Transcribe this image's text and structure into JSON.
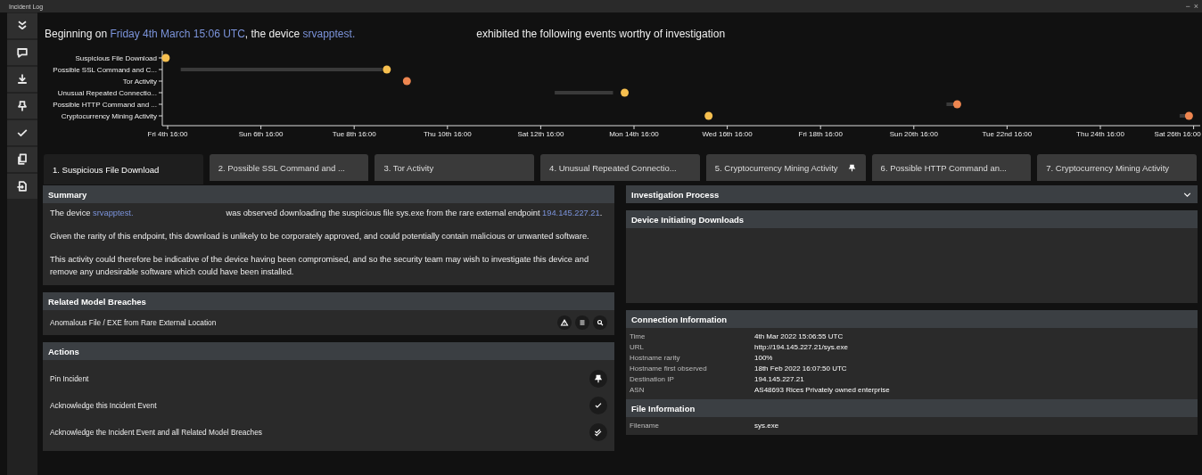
{
  "window": {
    "title": "Incident Log",
    "controls": [
      "−",
      "×"
    ]
  },
  "headline": {
    "parts": [
      {
        "kind": "text",
        "text": "Beginning on "
      },
      {
        "kind": "link",
        "text": "Friday 4th March 15:06 UTC"
      },
      {
        "kind": "text",
        "text": ", the device "
      },
      {
        "kind": "link",
        "text": "srvapptest."
      },
      {
        "kind": "gap"
      },
      {
        "kind": "text",
        "text": "exhibited the following events worthy of investigation"
      }
    ]
  },
  "timeline": {
    "row_labels": [
      "Suspicious File Download",
      "Possible SSL Command and C...",
      "Tor Activity",
      "Unusual Repeated Connectio...",
      "Possible HTTP Command and ...",
      "Cryptocurrency Mining Activity"
    ],
    "date_labels": [
      "Fri 4th 16:00",
      "Sun 6th 16:00",
      "Tue 8th 16:00",
      "Thu 10th 16:00",
      "Sat 12th 16:00",
      "Mon 14th 16:00",
      "Wed 16th 16:00",
      "Fri 18th 16:00",
      "Sun 20th 16:00",
      "Tue 22nd 16:00",
      "Thu 24th 16:00",
      "Sat 26th 16:00"
    ]
  },
  "tabs": [
    {
      "label": "1. Suspicious File Download",
      "selected": true,
      "pinned": false
    },
    {
      "label": "2. Possible SSL Command and ...",
      "selected": false,
      "pinned": false
    },
    {
      "label": "3. Tor Activity",
      "selected": false,
      "pinned": false
    },
    {
      "label": "4. Unusual Repeated Connectio...",
      "selected": false,
      "pinned": false
    },
    {
      "label": "5. Cryptocurrency Mining Activity",
      "selected": false,
      "pinned": true
    },
    {
      "label": "6. Possible HTTP Command an...",
      "selected": false,
      "pinned": false
    },
    {
      "label": "7. Cryptocurrency Mining Activity",
      "selected": false,
      "pinned": false
    }
  ],
  "summary": {
    "title": "Summary",
    "paragraphs": [
      [
        {
          "kind": "text",
          "text": "The device "
        },
        {
          "kind": "link",
          "text": "srvapptest."
        },
        {
          "kind": "gap"
        },
        {
          "kind": "text",
          "text": "was observed downloading the suspicious file sys.exe from the rare external endpoint "
        },
        {
          "kind": "link",
          "text": "194.145.227.21"
        },
        {
          "kind": "text",
          "text": "."
        }
      ],
      [
        {
          "kind": "text",
          "text": "Given the rarity of this endpoint, this download is unlikely to be corporately approved, and could potentially contain malicious or unwanted software."
        }
      ],
      [
        {
          "kind": "text",
          "text": "This activity could therefore be indicative of the device having been compromised, and so the security team may wish to investigate this device and remove any undesirable software which could have been installed."
        }
      ]
    ]
  },
  "related_model_breaches": {
    "title": "Related Model Breaches",
    "items": [
      {
        "label": "Anomalous File / EXE from Rare External Location"
      }
    ]
  },
  "actions": {
    "title": "Actions",
    "items": [
      {
        "label": "Pin Incident"
      },
      {
        "label": "Acknowledge this Incident Event"
      },
      {
        "label": "Acknowledge the Incident Event and all Related Model Breaches"
      }
    ]
  },
  "investigation_process": {
    "title": "Investigation Process",
    "expanded": false
  },
  "device_initiating_downloads": {
    "title": "Device Initiating Downloads"
  },
  "connection_information": {
    "title": "Connection Information",
    "rows": [
      {
        "label": "Time",
        "value": "4th Mar 2022 15:06:55 UTC"
      },
      {
        "label": "URL",
        "value": "http://194.145.227.21/sys.exe"
      },
      {
        "label": "Hostname rarity",
        "value": "100%"
      },
      {
        "label": "Hostname first observed",
        "value": "18th Feb 2022 16:07:50 UTC"
      },
      {
        "label": "Destination IP",
        "value": "194.145.227.21"
      },
      {
        "label": "ASN",
        "value": "AS48693 Rices Privately owned enterprise"
      }
    ]
  },
  "file_information": {
    "title": "File Information",
    "rows": [
      {
        "label": "Filename",
        "value": "sys.exe"
      }
    ]
  }
}
